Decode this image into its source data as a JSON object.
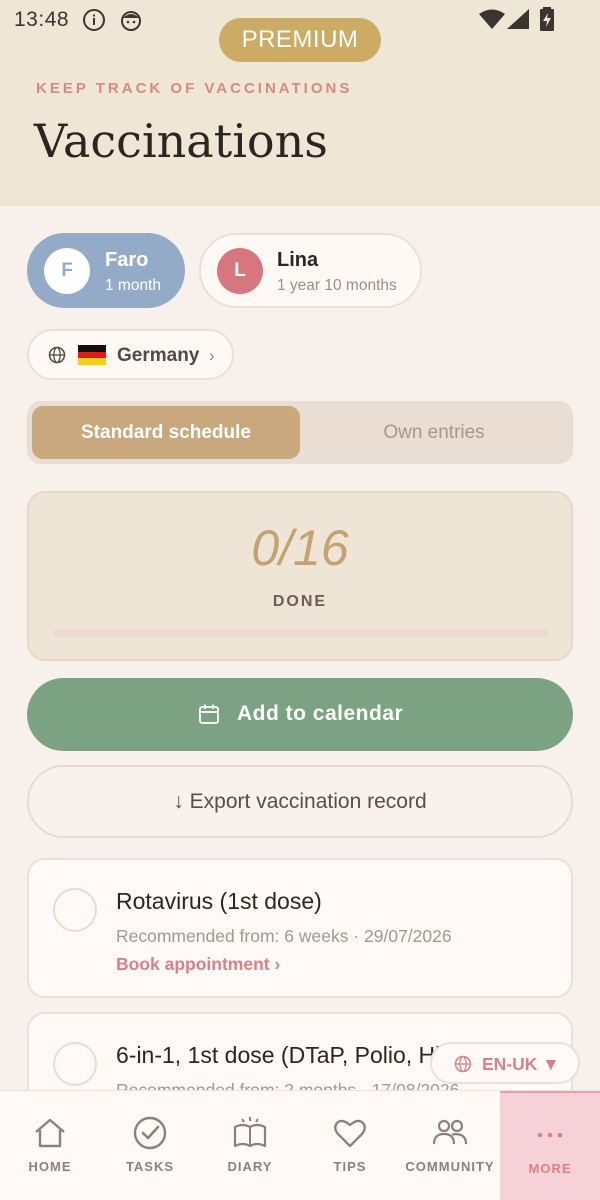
{
  "status_bar": {
    "time": "13:48"
  },
  "header": {
    "premium_label": "PREMIUM",
    "overline": "KEEP TRACK OF VACCINATIONS",
    "title": "Vaccinations"
  },
  "children": [
    {
      "initial": "F",
      "name": "Faro",
      "age": "1 month",
      "selected": true
    },
    {
      "initial": "L",
      "name": "Lina",
      "age": "1 year 10 months",
      "selected": false
    }
  ],
  "country": {
    "flag": "germany-flag-icon",
    "name": "Germany",
    "chevron": "›"
  },
  "schedule_tabs": {
    "active": "Standard schedule",
    "inactive": "Own entries"
  },
  "progress": {
    "count": "0/16",
    "label": "DONE",
    "fraction": 0
  },
  "actions": {
    "calendar_label": "Add to calendar",
    "export_label": "↓ Export vaccination record"
  },
  "vaccines": [
    {
      "name": "Rotavirus (1st dose)",
      "recommended": "Recommended from: 6 weeks · 29/07/2026",
      "book": "Book appointment ›"
    },
    {
      "name": "6-in-1, 1st dose (DTaP, Polio, Hib, HepB)",
      "recommended": "Recommended from: 2 months · 17/08/2026"
    }
  ],
  "language": {
    "label": "EN-UK ▼"
  },
  "nav": [
    {
      "label": "HOME",
      "icon": "home-icon"
    },
    {
      "label": "TASKS",
      "icon": "check-circle-icon"
    },
    {
      "label": "DIARY",
      "icon": "book-icon"
    },
    {
      "label": "TIPS",
      "icon": "heart-icon"
    },
    {
      "label": "COMMUNITY",
      "icon": "people-icon"
    },
    {
      "label": "MORE",
      "icon": "more-dots-icon",
      "active": true
    }
  ],
  "colors": {
    "header_bg": "#efe6d6",
    "accent_pink": "#d8818a",
    "accent_gold": "#ccab64",
    "green_button": "#7ba283",
    "faro_chip": "#94abc8"
  }
}
